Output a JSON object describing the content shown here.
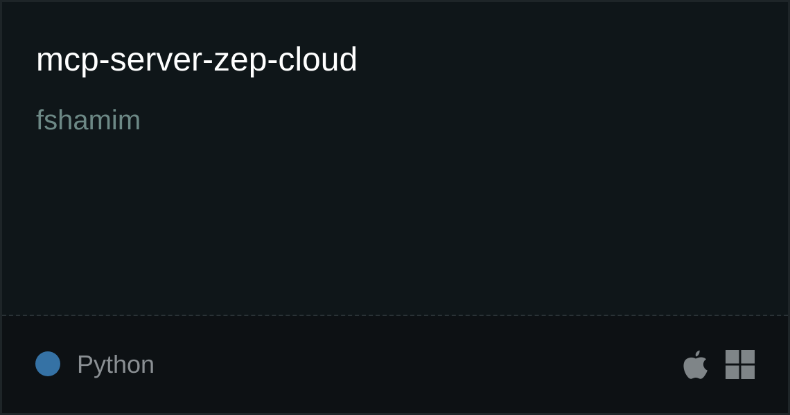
{
  "repo": {
    "name": "mcp-server-zep-cloud",
    "author": "fshamim"
  },
  "language": {
    "name": "Python",
    "color": "#3572A5"
  },
  "platforms": [
    {
      "name": "macOS",
      "icon": "apple-icon"
    },
    {
      "name": "Windows",
      "icon": "windows-icon"
    }
  ],
  "colors": {
    "title": "#ffffff",
    "author": "#6d8986",
    "icon": "#7f8588"
  }
}
